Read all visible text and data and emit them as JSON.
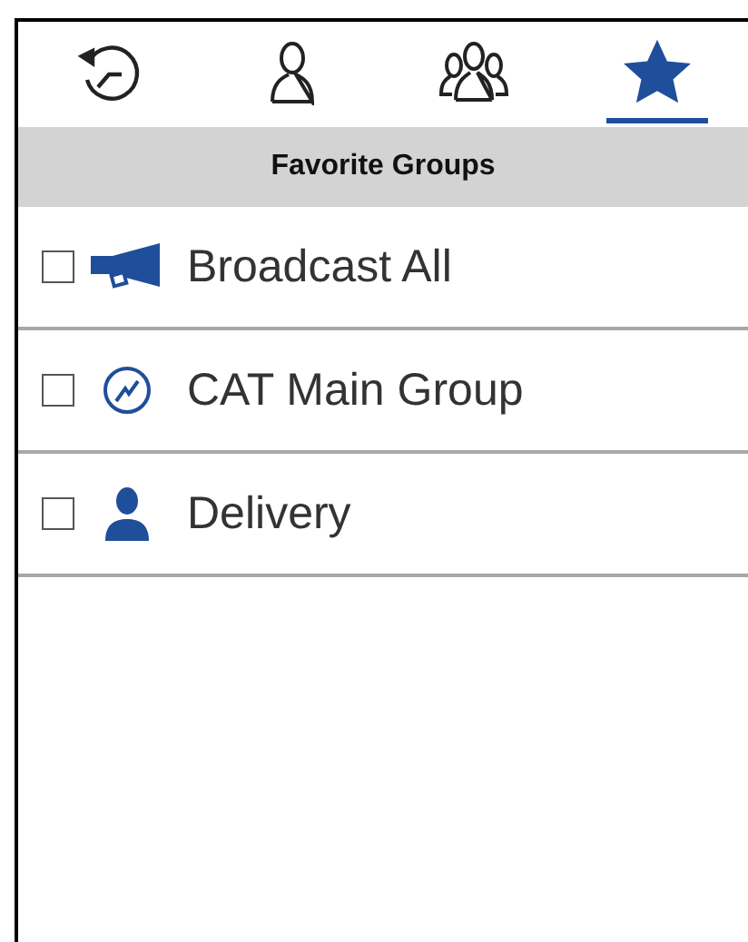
{
  "tabs": [
    {
      "kind": "recent",
      "selected": false
    },
    {
      "kind": "contact",
      "selected": false
    },
    {
      "kind": "groups",
      "selected": false
    },
    {
      "kind": "favorites",
      "selected": true
    }
  ],
  "header": {
    "title": "Favorite Groups"
  },
  "items": [
    {
      "kind": "broadcast",
      "label": "Broadcast All",
      "checked": false
    },
    {
      "kind": "group",
      "label": "CAT Main Group",
      "checked": false
    },
    {
      "kind": "person",
      "label": "Delivery",
      "checked": false
    }
  ]
}
